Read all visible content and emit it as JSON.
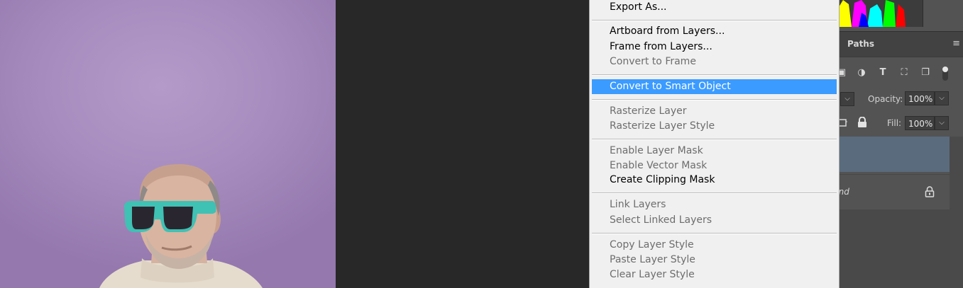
{
  "context_menu": {
    "items": [
      {
        "label": "Export As...",
        "enabled": true
      },
      {
        "label": "Artboard from Layers...",
        "enabled": true
      },
      {
        "label": "Frame from Layers...",
        "enabled": true
      },
      {
        "label": "Convert to Frame",
        "enabled": false
      },
      {
        "label": "Convert to Smart Object",
        "enabled": true,
        "highlighted": true
      },
      {
        "label": "Rasterize Layer",
        "enabled": false
      },
      {
        "label": "Rasterize Layer Style",
        "enabled": false
      },
      {
        "label": "Enable Layer Mask",
        "enabled": false
      },
      {
        "label": "Enable Vector Mask",
        "enabled": false
      },
      {
        "label": "Create Clipping Mask",
        "enabled": true
      },
      {
        "label": "Link Layers",
        "enabled": false
      },
      {
        "label": "Select Linked Layers",
        "enabled": false
      },
      {
        "label": "Copy Layer Style",
        "enabled": false
      },
      {
        "label": "Paste Layer Style",
        "enabled": false
      },
      {
        "label": "Clear Layer Style",
        "enabled": false
      }
    ],
    "highlight_color": "#3c9bff"
  },
  "layers_panel": {
    "tab_label": "Paths",
    "opacity_label": "Opacity:",
    "opacity_value": "100%",
    "fill_label": "Fill:",
    "fill_value": "100%",
    "background_layer_partial": "und",
    "selected_layer_color": "#5a6b7d"
  },
  "icons": [
    "panel-menu-icon",
    "image-filter-icon",
    "adjustment-filter-icon",
    "type-filter-icon",
    "shape-filter-icon",
    "smart-object-filter-icon",
    "filter-toggle-icon",
    "lock-artboard-icon",
    "lock-all-icon",
    "layer-lock-icon"
  ]
}
